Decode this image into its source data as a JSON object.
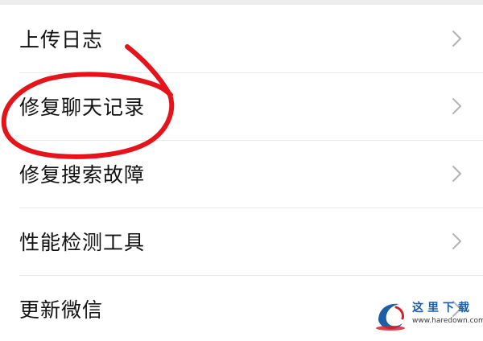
{
  "menu": {
    "items": [
      {
        "label": "上传日志"
      },
      {
        "label": "修复聊天记录"
      },
      {
        "label": "修复搜索故障"
      },
      {
        "label": "性能检测工具"
      },
      {
        "label": "更新微信"
      }
    ]
  },
  "annotation": {
    "shape": "hand-drawn circle",
    "target_item": "修复聊天记录",
    "color": "#e5141b"
  },
  "watermark": {
    "name": "这里下载",
    "url": "www.haredown.com"
  },
  "colors": {
    "background": "#ffffff",
    "text": "#111111",
    "divider": "#e9e9e9",
    "chevron": "#b3b3b3"
  }
}
